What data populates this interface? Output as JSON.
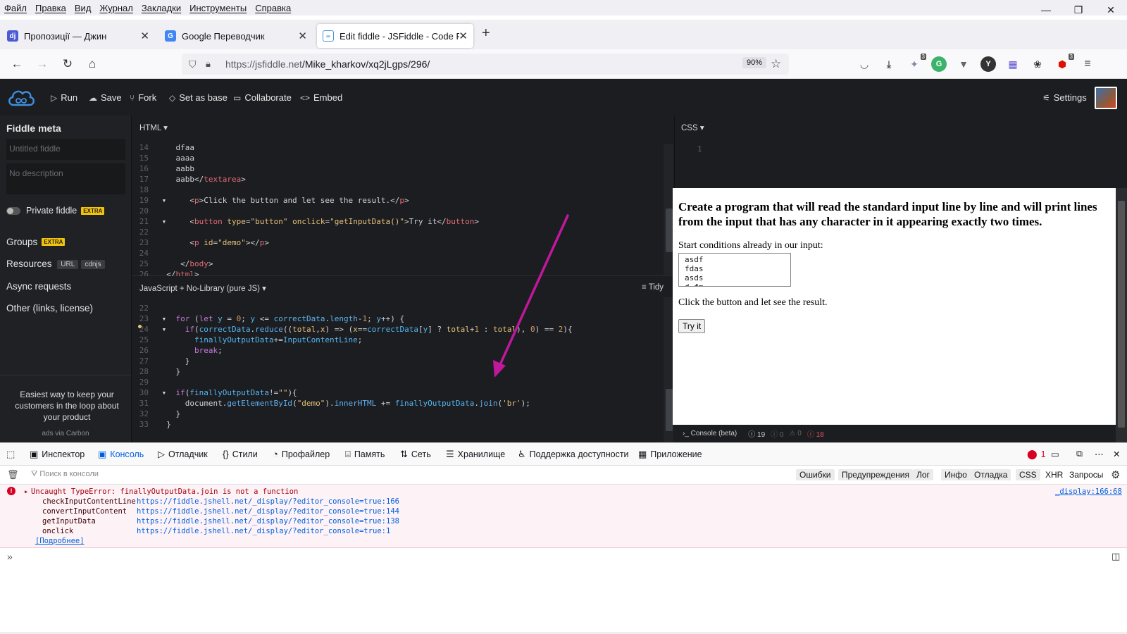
{
  "menubar": [
    "Файл",
    "Правка",
    "Вид",
    "Журнал",
    "Закладки",
    "Инструменты",
    "Справка"
  ],
  "tabs": [
    {
      "title": "Пропозиції — Джин",
      "active": false,
      "favicon": "dj-icon"
    },
    {
      "title": "Google Переводчик",
      "active": false,
      "favicon": "translate-icon"
    },
    {
      "title": "Edit fiddle - JSFiddle - Code Pla",
      "active": true,
      "favicon": "jsfiddle-icon"
    }
  ],
  "nav": {
    "url_prefix": "https://jsfiddle.net",
    "url_path": "/Mike_kharkov/xq2jLgps/296/",
    "zoom": "90%"
  },
  "extensions": {
    "badge1": "3",
    "badge2": "3"
  },
  "jsfiddle": {
    "actions": [
      "Run",
      "Save",
      "Fork",
      "Set as base",
      "Collaborate",
      "Embed"
    ],
    "settings": "Settings"
  },
  "sidebar": {
    "title": "Fiddle meta",
    "name_placeholder": "Untitled fiddle",
    "desc_placeholder": "No description",
    "private": "Private fiddle",
    "extra": "EXTRA",
    "groups": "Groups",
    "resources": "Resources",
    "url_pill": "URL",
    "cdnjs_pill": "cdnjs",
    "async": "Async requests",
    "other": "Other (links, license)",
    "ad_text": "Easiest way to keep your customers in the loop about your product",
    "ads_via": "ads via Carbon"
  },
  "html_pane": {
    "label": "HTML ▾"
  },
  "css_pane": {
    "label": "CSS ▾",
    "line": "1"
  },
  "js_pane": {
    "label": "JavaScript + No-Library (pure JS) ▾",
    "tidy": "Tidy"
  },
  "console_bar": {
    "label": "Console (beta)",
    "c1": "19",
    "c2": "0",
    "c3": "0",
    "c4": "18"
  },
  "result": {
    "heading": "Create a program that will read the standard input line by line and will print lines from the input that has any character in it appearing exactly two times.",
    "start": "Start conditions already in our input:",
    "textarea": "asdf\nfdas\nasds\nd fm",
    "click": "Click the button and let see the result.",
    "button": "Try it"
  },
  "devtools": {
    "tabs": [
      "Инспектор",
      "Консоль",
      "Отладчик",
      "Стили",
      "Профайлер",
      "Память",
      "Сеть",
      "Хранилище",
      "Поддержка доступности",
      "Приложение"
    ],
    "error_count": "1",
    "filter_placeholder": "Поиск в консоли",
    "filters": [
      "Ошибки",
      "Предупреждения",
      "Лог",
      "Инфо",
      "Отладка",
      "CSS",
      "XHR",
      "Запросы"
    ],
    "error": {
      "message": "Uncaught TypeError: finallyOutputData.join is not a function",
      "location": "_display:166:68",
      "stack": [
        {
          "fn": "checkInputContentLine",
          "src": "https://fiddle.jshell.net/_display/?editor_console=true:166"
        },
        {
          "fn": "convertInputContent",
          "src": "https://fiddle.jshell.net/_display/?editor_console=true:144"
        },
        {
          "fn": "getInputData",
          "src": "https://fiddle.jshell.net/_display/?editor_console=true:138"
        },
        {
          "fn": "onclick",
          "src": "https://fiddle.jshell.net/_display/?editor_console=true:1"
        }
      ],
      "more": "[Подробнее]"
    }
  },
  "colors": {
    "annotation_arrow": "#c0189a",
    "jsfiddle_dark": "#1b1d20",
    "error_red": "#d70022"
  }
}
